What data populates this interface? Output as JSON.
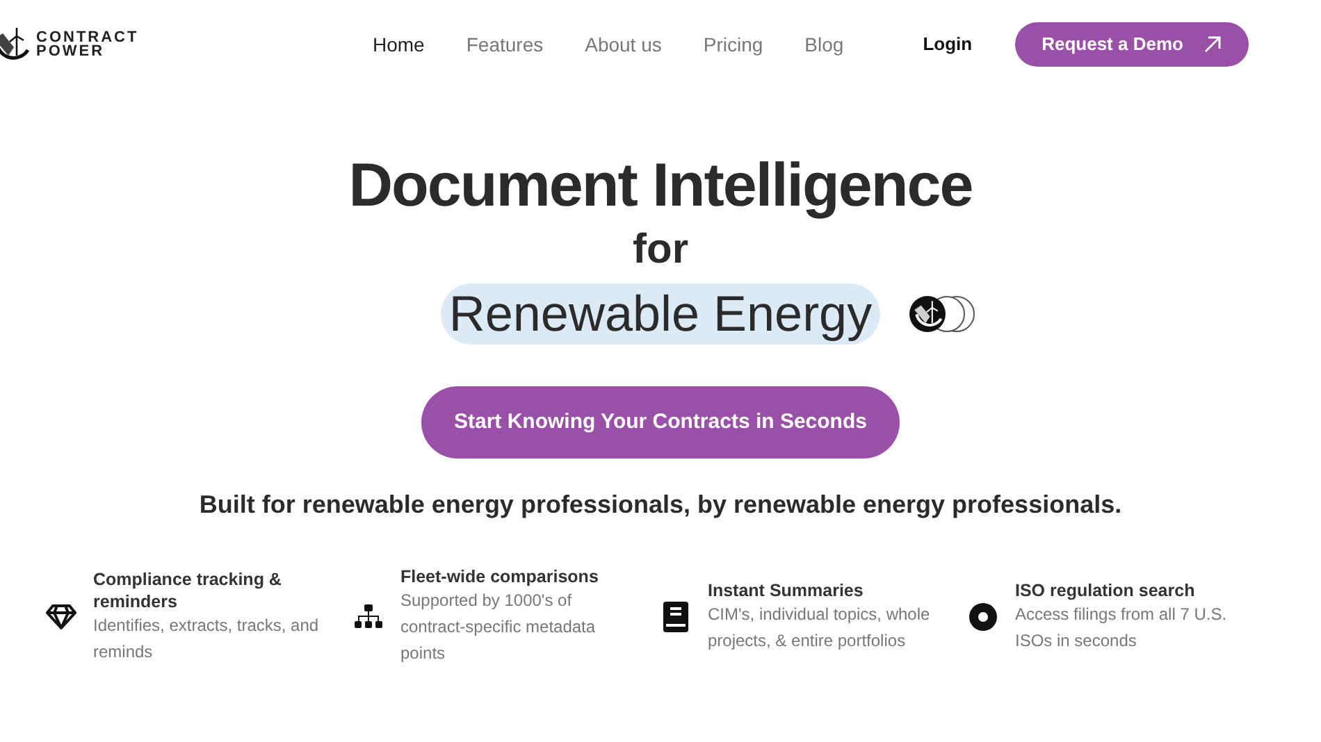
{
  "logo": {
    "line_1": "CONTRACT",
    "line_2": "POWER"
  },
  "nav": [
    {
      "label": "Home",
      "selected": true
    },
    {
      "label": "Features",
      "selected": false
    },
    {
      "label": "About us",
      "selected": false
    },
    {
      "label": "Pricing",
      "selected": false
    },
    {
      "label": "Blog",
      "selected": false
    }
  ],
  "login": "Login",
  "demo_button": "Request a Demo",
  "hero": {
    "title": "Document Intelligence",
    "connector": "for",
    "highlight": "Renewable Energy",
    "cta": "Start Knowing Your Contracts in Seconds",
    "tagline": "Built for renewable energy professionals, by renewable energy professionals."
  },
  "features": [
    {
      "kind": "diamond",
      "title": "Compliance tracking & reminders",
      "text": "Identifies, extracts, tracks, and reminds"
    },
    {
      "kind": "hierarchy",
      "title": "Fleet-wide comparisons",
      "text": "Supported by 1000's of contract-specific metadata points"
    },
    {
      "kind": "book",
      "title": "Instant Summaries",
      "text": "CIM's, individual topics, whole projects, & entire portfolios"
    },
    {
      "kind": "disc",
      "title": "ISO regulation search",
      "text": "Access filings from all 7 U.S. ISOs in seconds"
    }
  ]
}
